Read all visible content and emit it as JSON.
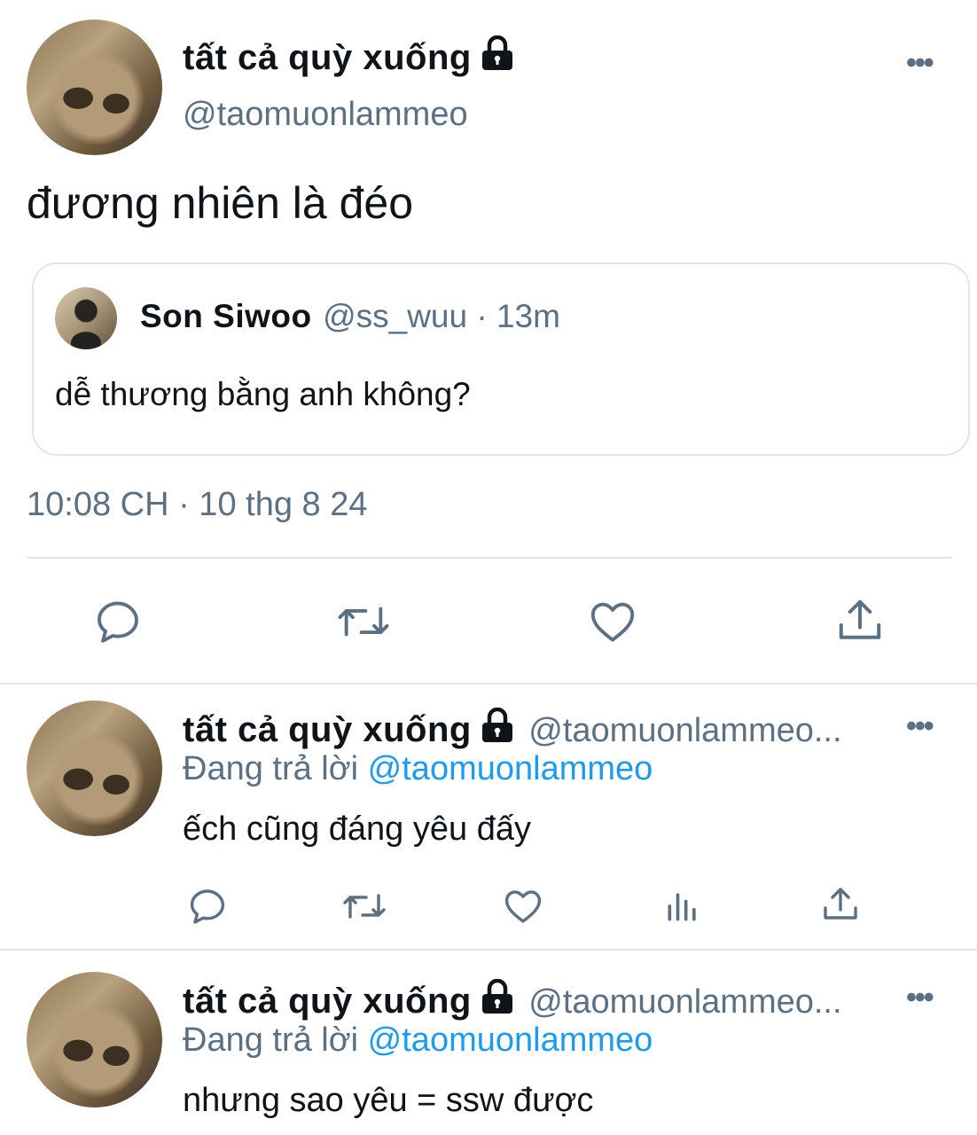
{
  "main_tweet": {
    "author_name": "tất cả quỳ xuống",
    "handle": "@taomuonlammeo",
    "text": "đương nhiên là đéo",
    "timestamp": "10:08 CH · 10 thg 8 24",
    "quoted": {
      "author_name": "Son Siwoo",
      "meta": "@ss_wuu · 13m",
      "text": "dễ thương bằng anh không?"
    }
  },
  "replies": [
    {
      "author_name": "tất cả quỳ xuống",
      "handle": "@taomuonlammeo...",
      "replying_label": "Đang trả lời",
      "replying_to": "@taomuonlammeo",
      "text": "ếch cũng đáng yêu đấy"
    },
    {
      "author_name": "tất cả quỳ xuống",
      "handle": "@taomuonlammeo...",
      "replying_label": "Đang trả lời",
      "replying_to": "@taomuonlammeo",
      "text": "nhưng sao yêu = ssw được"
    }
  ],
  "more_label": "•••",
  "icons": [
    "lock-icon",
    "reply-icon",
    "retweet-icon",
    "like-icon",
    "share-icon",
    "analytics-icon",
    "more-icon"
  ],
  "colors": {
    "text": "#0f1419",
    "secondary": "#5b7083",
    "link": "#1d9bf0",
    "divider": "#e1e8ed"
  }
}
